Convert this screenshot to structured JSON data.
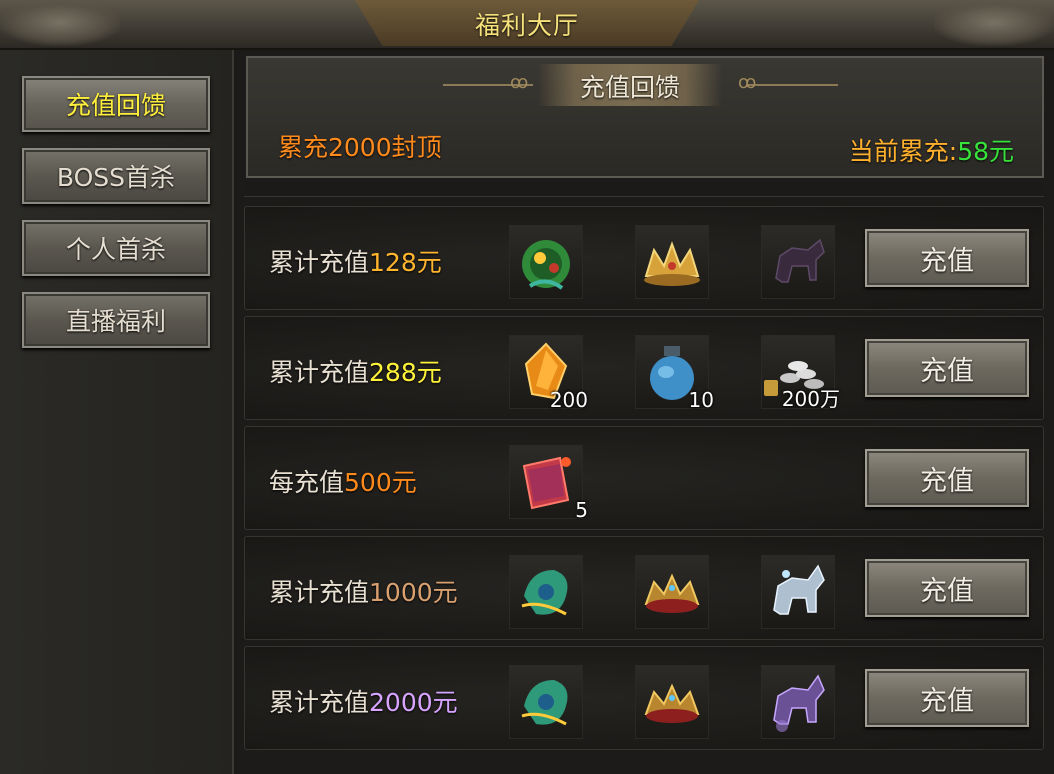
{
  "window": {
    "title": "福利大厅"
  },
  "sidebar": {
    "items": [
      {
        "label": "充值回馈",
        "active": true
      },
      {
        "label": "BOSS首杀",
        "active": false
      },
      {
        "label": "个人首杀",
        "active": false
      },
      {
        "label": "直播福利",
        "active": false
      }
    ]
  },
  "header": {
    "section_title": "充值回馈",
    "cap_text": "累充2000封顶",
    "current_total_label": "当前累充:",
    "current_total_value": "58元"
  },
  "colors": {
    "amount_128": "#ffb52e",
    "amount_288": "#fff33a",
    "amount_500": "#ff8a1c",
    "amount_1000": "#d9a070",
    "amount_2000": "#d7a4ff"
  },
  "rows": [
    {
      "prefix": "累计充值",
      "amount": "128元",
      "button": "充值",
      "items": [
        {
          "icon": "jade-ornament-icon",
          "count": ""
        },
        {
          "icon": "golden-crown-icon",
          "count": ""
        },
        {
          "icon": "dark-horse-mount-icon",
          "count": ""
        }
      ]
    },
    {
      "prefix": "累计充值",
      "amount": "288元",
      "button": "充值",
      "items": [
        {
          "icon": "amber-crystal-icon",
          "count": "200"
        },
        {
          "icon": "blue-potion-jar-icon",
          "count": "10"
        },
        {
          "icon": "silver-coins-icon",
          "count": "200万"
        }
      ]
    },
    {
      "prefix": "每充值",
      "amount": "500元",
      "button": "充值",
      "items": [
        {
          "icon": "red-book-icon",
          "count": "5"
        }
      ]
    },
    {
      "prefix": "累计充值",
      "amount": "1000元",
      "button": "充值",
      "items": [
        {
          "icon": "jade-dragon-ornament-icon",
          "count": ""
        },
        {
          "icon": "red-crown-icon",
          "count": ""
        },
        {
          "icon": "ice-horse-mount-icon",
          "count": ""
        }
      ]
    },
    {
      "prefix": "累计充值",
      "amount": "2000元",
      "button": "充值",
      "items": [
        {
          "icon": "jade-dragon-ornament-icon",
          "count": ""
        },
        {
          "icon": "red-crown-icon",
          "count": ""
        },
        {
          "icon": "purple-horse-mount-icon",
          "count": ""
        }
      ]
    }
  ]
}
